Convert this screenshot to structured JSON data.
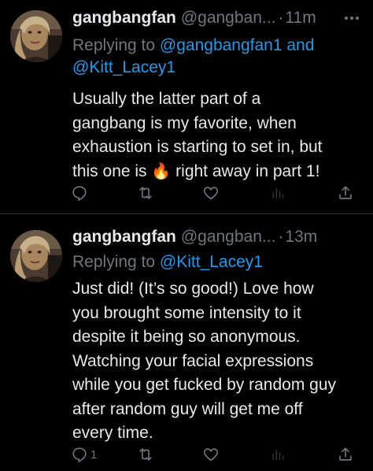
{
  "tweets": [
    {
      "display_name": "gangbangfan",
      "handle": "@gangban...",
      "separator": "·",
      "time": "11m",
      "reply_prefix": "Replying to",
      "reply_mention_1": "@gangbangfan1",
      "reply_conjunction": "and",
      "reply_mention_2": "@Kitt_Lacey1",
      "body_lines": [
        "Usually the latter part of a",
        "gangbang is my favorite, when",
        "exhaustion is starting to set in, but",
        "this one is",
        "right away in part 1!"
      ],
      "emoji": "🔥",
      "reply_count": "",
      "icons": {
        "more": "more-icon",
        "reply": "reply-icon",
        "retweet": "retweet-icon",
        "like": "like-icon",
        "views": "views-icon",
        "share": "share-icon"
      }
    },
    {
      "display_name": "gangbangfan",
      "handle": "@gangban...",
      "separator": "·",
      "time": "13m",
      "reply_prefix": "Replying to",
      "reply_mention_1": "@Kitt_Lacey1",
      "body_lines": [
        "Just did! (It’s so good!) Love how",
        "you brought some intensity to it",
        "despite it being so anonymous.",
        "Watching your facial expressions",
        "while you get fucked by random guy",
        "after random guy will get me off",
        "every time."
      ],
      "reply_count": "1",
      "icons": {
        "more": "more-icon",
        "reply": "reply-icon",
        "retweet": "retweet-icon",
        "like": "like-icon",
        "views": "views-icon",
        "share": "share-icon"
      }
    }
  ],
  "colors": {
    "background": "#000000",
    "text": "#e7e9ea",
    "muted": "#71767b",
    "accent": "#1d9bf0",
    "divider": "#2f3336"
  }
}
